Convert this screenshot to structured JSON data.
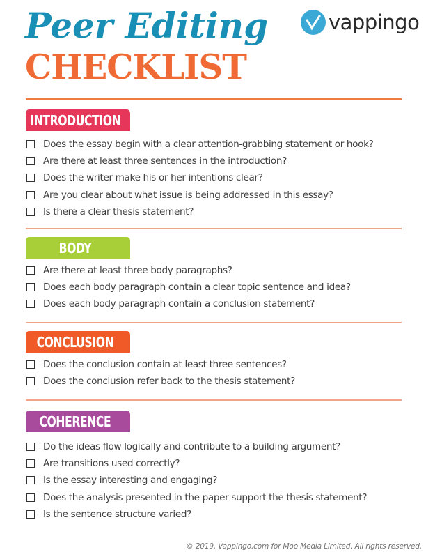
{
  "header": {
    "title_script": "Peer Editing",
    "title_main": "CHECKLIST",
    "title_script_color": "#1a8fb5",
    "title_main_color": "#ef6a34"
  },
  "logo": {
    "icon": "checkmark-circle-icon",
    "text": "vappingo",
    "color": "#3aa9d6"
  },
  "sections": [
    {
      "label": "INTRODUCTION",
      "color": "#e6375a",
      "items": [
        "Does the essay begin with a clear attention-grabbing statement or hook?",
        "Are there at least three sentences in the introduction?",
        "Does the writer make his or her intentions clear?",
        "Are you clear about what issue is being addressed in this essay?",
        "Is there a clear thesis statement?"
      ]
    },
    {
      "label": "BODY",
      "color": "#a8cf38",
      "items": [
        "Are there at least three body paragraphs?",
        "Does each body paragraph contain a clear topic sentence and idea?",
        "Does each body paragraph contain a conclusion statement?"
      ]
    },
    {
      "label": "CONCLUSION",
      "color": "#f05a28",
      "items": [
        "Does the conclusion contain at least three sentences?",
        "Does the conclusion refer back to the thesis statement?"
      ]
    },
    {
      "label": "COHERENCE",
      "color": "#a94b9c",
      "items": [
        "Do the ideas flow logically and contribute to a building argument?",
        "Are transitions used correctly?",
        "Is the essay interesting and engaging?",
        "Does the analysis presented in the paper support the thesis statement?",
        "Is the sentence structure varied?"
      ]
    }
  ],
  "footer": {
    "copyright": "© 2019, Vappingo.com for Moo Media Limited. All rights reserved."
  }
}
